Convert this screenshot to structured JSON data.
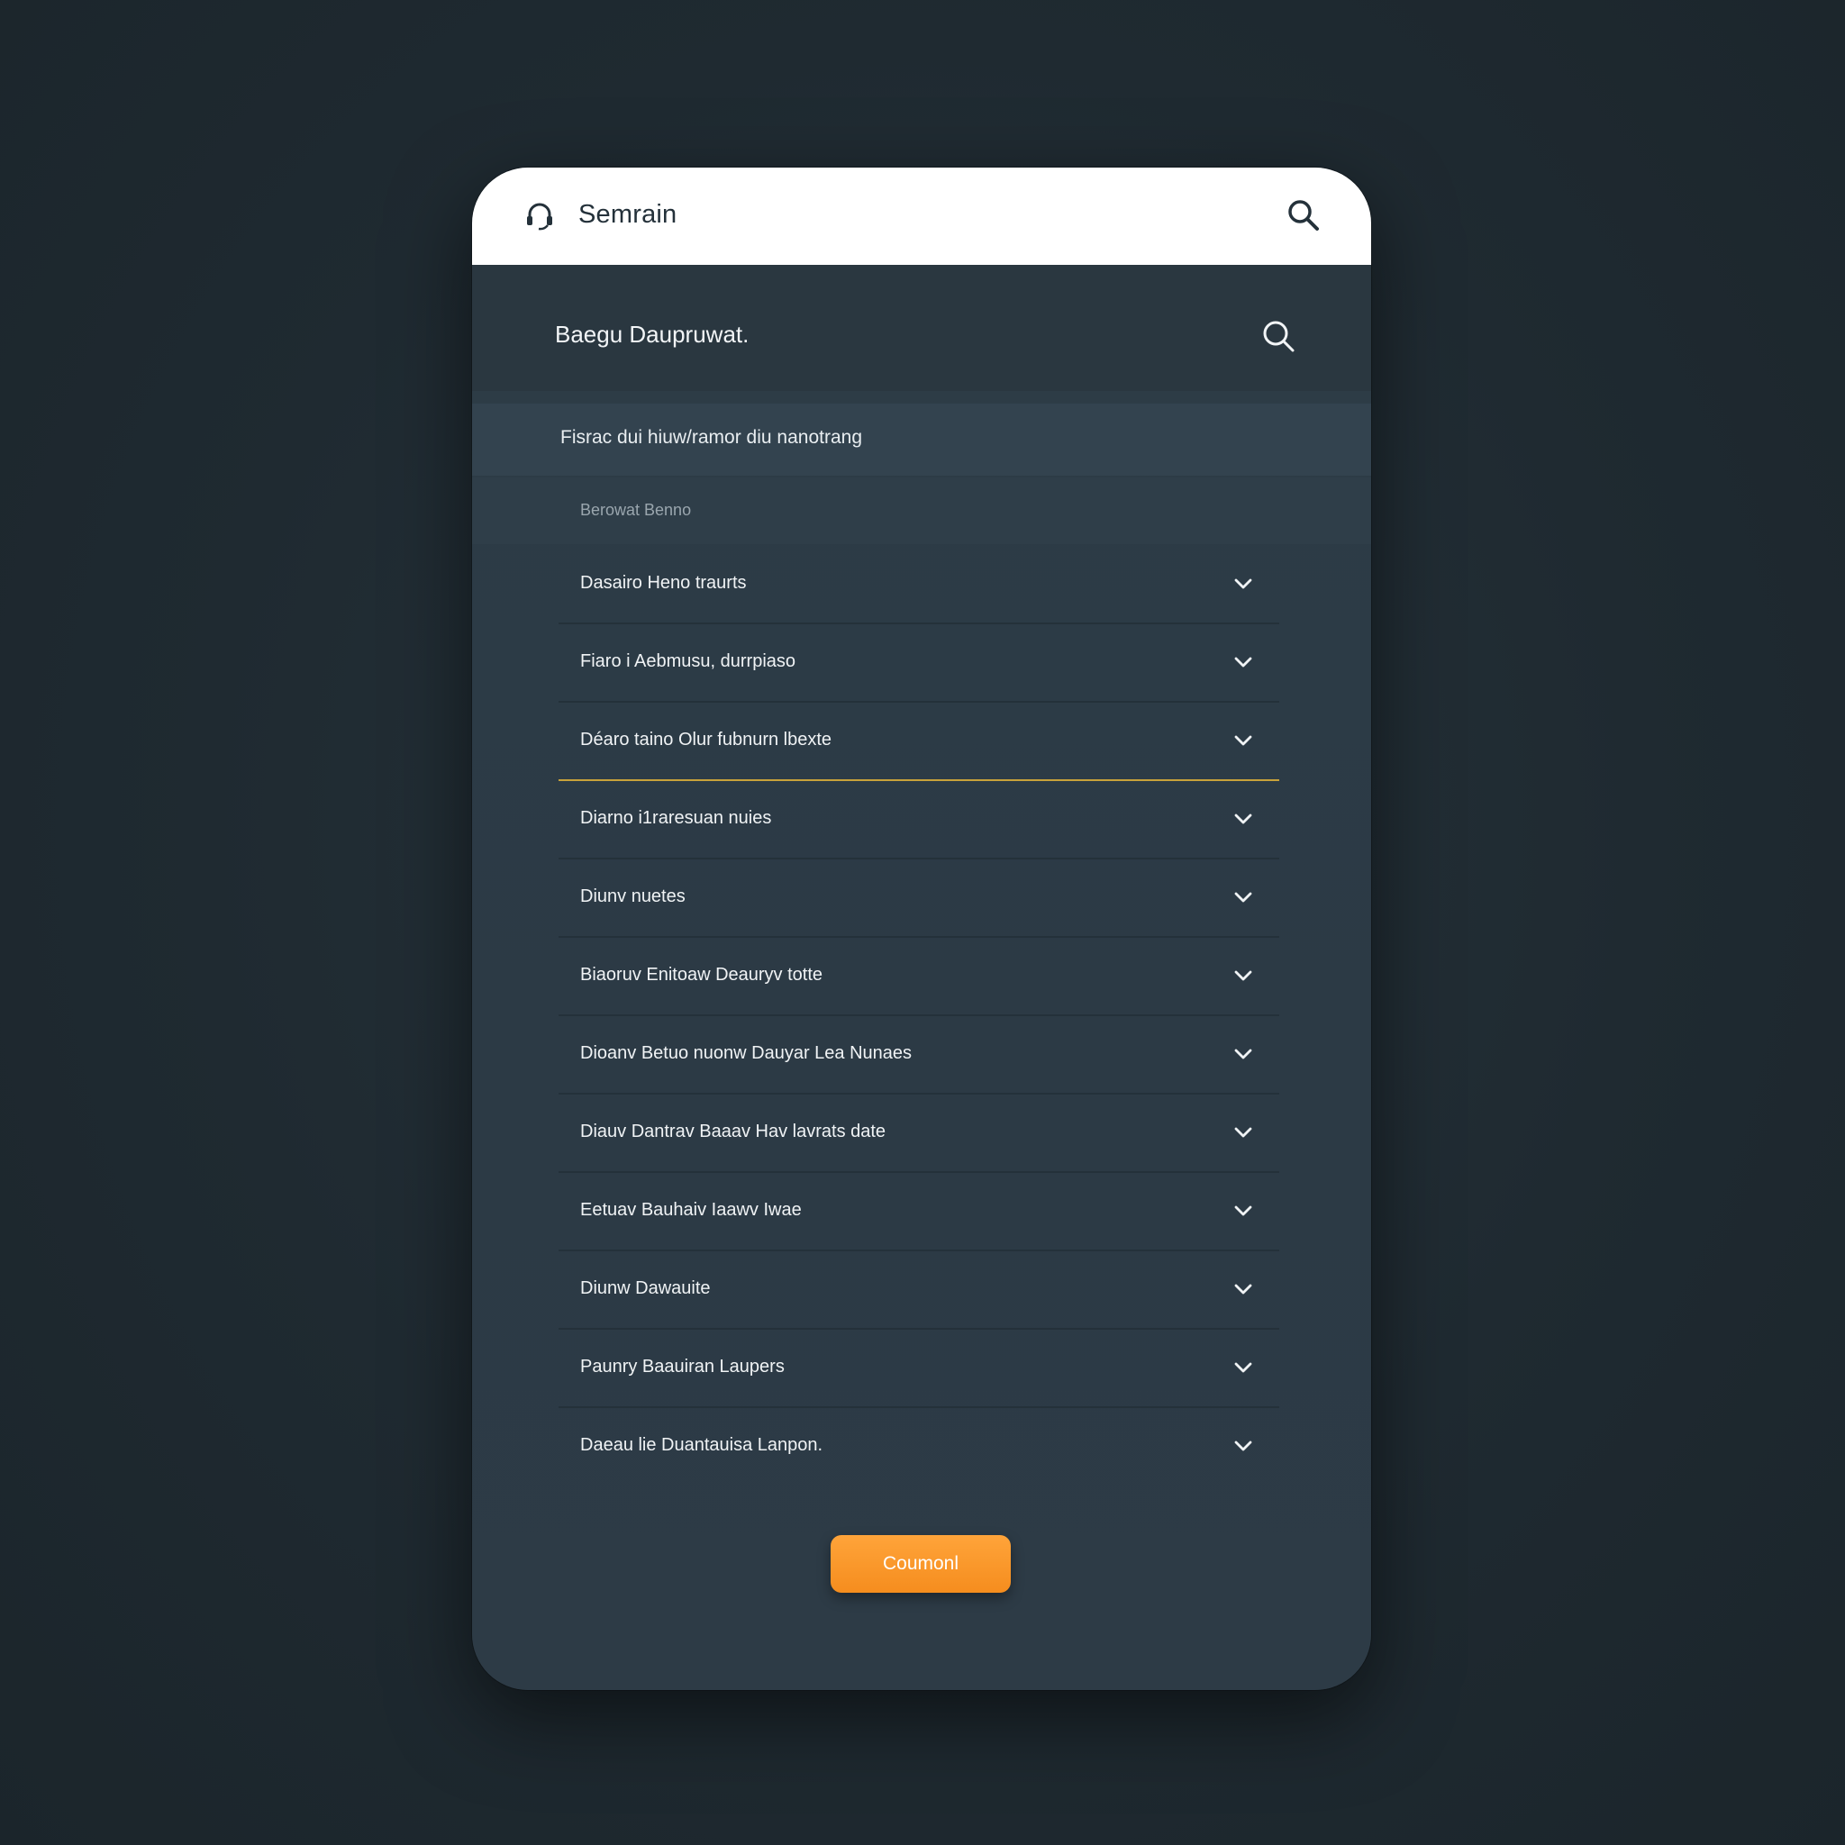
{
  "topbar": {
    "title": "Semrain",
    "brand_icon": "headset-icon",
    "search_icon": "search-icon"
  },
  "header": {
    "title": "Baegu Daupruwat.",
    "search_icon": "search-icon"
  },
  "subheader": {
    "text": "Fisrac dui hiuw/ramor diu nanotrang"
  },
  "filter": {
    "placeholder": "Berowat Benno"
  },
  "list": {
    "items": [
      {
        "label": "Dasairo Heno traurts",
        "icon": "chevron-down-icon"
      },
      {
        "label": "Fiaro i Aebmusu, durrpiaso",
        "icon": "chevron-down-icon"
      },
      {
        "label": "Déaro taino Olur fubnurn lbexte",
        "icon": "chevron-down-icon",
        "active": true
      },
      {
        "label": "Diarno i1raresuan nuies",
        "icon": "chevron-down-icon"
      },
      {
        "label": "Diunv nuetes",
        "icon": "chevron-down-icon"
      },
      {
        "label": "Biaoruv Enitoaw Deauryv totte",
        "icon": "chevron-down-icon"
      },
      {
        "label": "Dioanv Betuo nuonw Dauyar Lea Nunaes",
        "icon": "chevron-down-icon"
      },
      {
        "label": "Diauv Dantrav Baaav Hav lavrats date",
        "icon": "chevron-down-icon"
      },
      {
        "label": "Eetuav Bauhaiv Iaawv Iwae",
        "icon": "chevron-down-icon"
      },
      {
        "label": "Diunw Dawauite",
        "icon": "chevron-down-icon"
      },
      {
        "label": "Paunry Baauiran Laupers",
        "icon": "chevron-down-icon"
      },
      {
        "label": "Daeau lie Duantauisa Lanpon.",
        "icon": "chevron-down-icon"
      }
    ]
  },
  "cta": {
    "label": "Coumonl",
    "color": "#f7941f"
  },
  "colors": {
    "background": "#1f2a31",
    "panel": "#2c3a45",
    "accent": "#f7941f",
    "active_underline": "#c8a23a"
  }
}
